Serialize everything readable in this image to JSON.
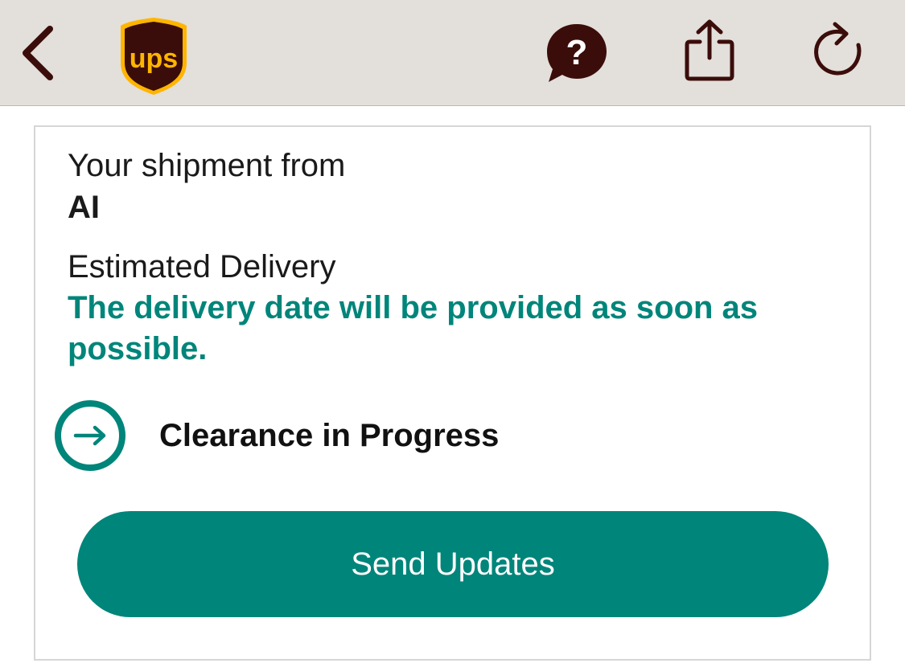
{
  "header": {
    "back_icon": "chevron-left-icon",
    "logo_text": "ups",
    "help_icon": "help-bubble-icon",
    "share_icon": "share-icon",
    "refresh_icon": "refresh-icon"
  },
  "shipment": {
    "from_label": "Your shipment from",
    "from_value": "AI",
    "estimated_label": "Estimated Delivery",
    "estimated_value": "The delivery date will be provided as soon as possible.",
    "status_icon": "arrow-right-circle-icon",
    "status_text": "Clearance in Progress"
  },
  "actions": {
    "send_updates_label": "Send Updates"
  },
  "colors": {
    "accent": "#00857a",
    "header_bg": "#e3dfda",
    "brand_brown": "#3b0d0a",
    "brand_gold": "#ffb500"
  }
}
